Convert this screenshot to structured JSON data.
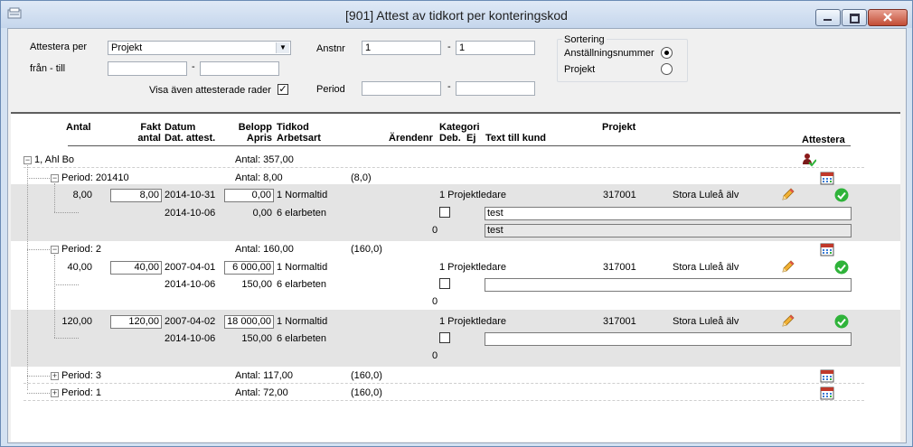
{
  "window": {
    "title": "[901]  Attest av tidkort per konteringskod"
  },
  "filters": {
    "attest_per_label": "Attestera per",
    "attest_per_value": "Projekt",
    "fran_till_label": "från - till",
    "anstnr_label": "Anstnr",
    "anstnr_from": "1",
    "anstnr_to": "1",
    "dash": "-",
    "period_label": "Period",
    "show_attested_label": "Visa även attesterade rader",
    "show_attested_mark": "✓"
  },
  "sorting": {
    "title": "Sortering",
    "option1": "Anställningsnummer",
    "option2": "Projekt",
    "selected": "Anställningsnummer"
  },
  "headers": {
    "antal": "Antal",
    "fakt": "Fakt",
    "antal2": "antal",
    "datum": "Datum",
    "dat_attest": "Dat. attest.",
    "belopp": "Belopp",
    "apris": "Apris",
    "tidkod": "Tidkod",
    "arbetsart": "Arbetsart",
    "kategori": "Kategori",
    "arendenr": "Ärendenr",
    "deb": "Deb.",
    "ej": "Ej",
    "text_till_kund": "Text till kund",
    "projekt": "Projekt",
    "attestera": "Attestera"
  },
  "tree": {
    "person": "1, Ahl Bo",
    "person_total": "Antal: 357,00",
    "p201410": {
      "label": "Period: 201410",
      "total": "Antal: 8,00",
      "sum": "(8,0)"
    },
    "p2": {
      "label": "Period: 2",
      "total": "Antal: 160,00",
      "sum": "(160,0)"
    },
    "p3": {
      "label": "Period: 3",
      "total": "Antal: 117,00",
      "sum": "(160,0)"
    },
    "p1": {
      "label": "Period: 1",
      "total": "Antal: 72,00",
      "sum": "(160,0)"
    }
  },
  "rows": [
    {
      "antal": "8,00",
      "fakt": "8,00",
      "datum": "2014-10-31",
      "belopp": "0,00",
      "tidkod": "1 Normaltid",
      "kategori": "1 Projektledare",
      "projekt_nr": "317001",
      "projekt_namn": "Stora Luleå älv",
      "dat_attest": "2014-10-06",
      "apris": "0,00",
      "arbetsart": "6 elarbeten",
      "text": "test",
      "arende": "0",
      "text2": "test"
    },
    {
      "antal": "40,00",
      "fakt": "40,00",
      "datum": "2007-04-01",
      "belopp": "6 000,00",
      "tidkod": "1 Normaltid",
      "kategori": "1 Projektledare",
      "projekt_nr": "317001",
      "projekt_namn": "Stora Luleå älv",
      "dat_attest": "2014-10-06",
      "apris": "150,00",
      "arbetsart": "6 elarbeten",
      "text": "",
      "arende": "0"
    },
    {
      "antal": "120,00",
      "fakt": "120,00",
      "datum": "2007-04-02",
      "belopp": "18 000,00",
      "tidkod": "1 Normaltid",
      "kategori": "1 Projektledare",
      "projekt_nr": "317001",
      "projekt_namn": "Stora Luleå älv",
      "dat_attest": "2014-10-06",
      "apris": "150,00",
      "arbetsart": "6 elarbeten",
      "text": "",
      "arende": "0"
    }
  ],
  "tree_signs": {
    "minus": "−",
    "plus": "+"
  },
  "colors": {
    "row_band": "#e4e4e4",
    "attest_ok": "#2fb33a",
    "calendar": "#c0392b"
  },
  "icons": [
    "app-icon",
    "minimize-icon",
    "maximize-icon",
    "close-icon",
    "chevron-down-icon",
    "person-check-icon",
    "calendar-icon",
    "pencil-icon",
    "check-circle-icon"
  ]
}
